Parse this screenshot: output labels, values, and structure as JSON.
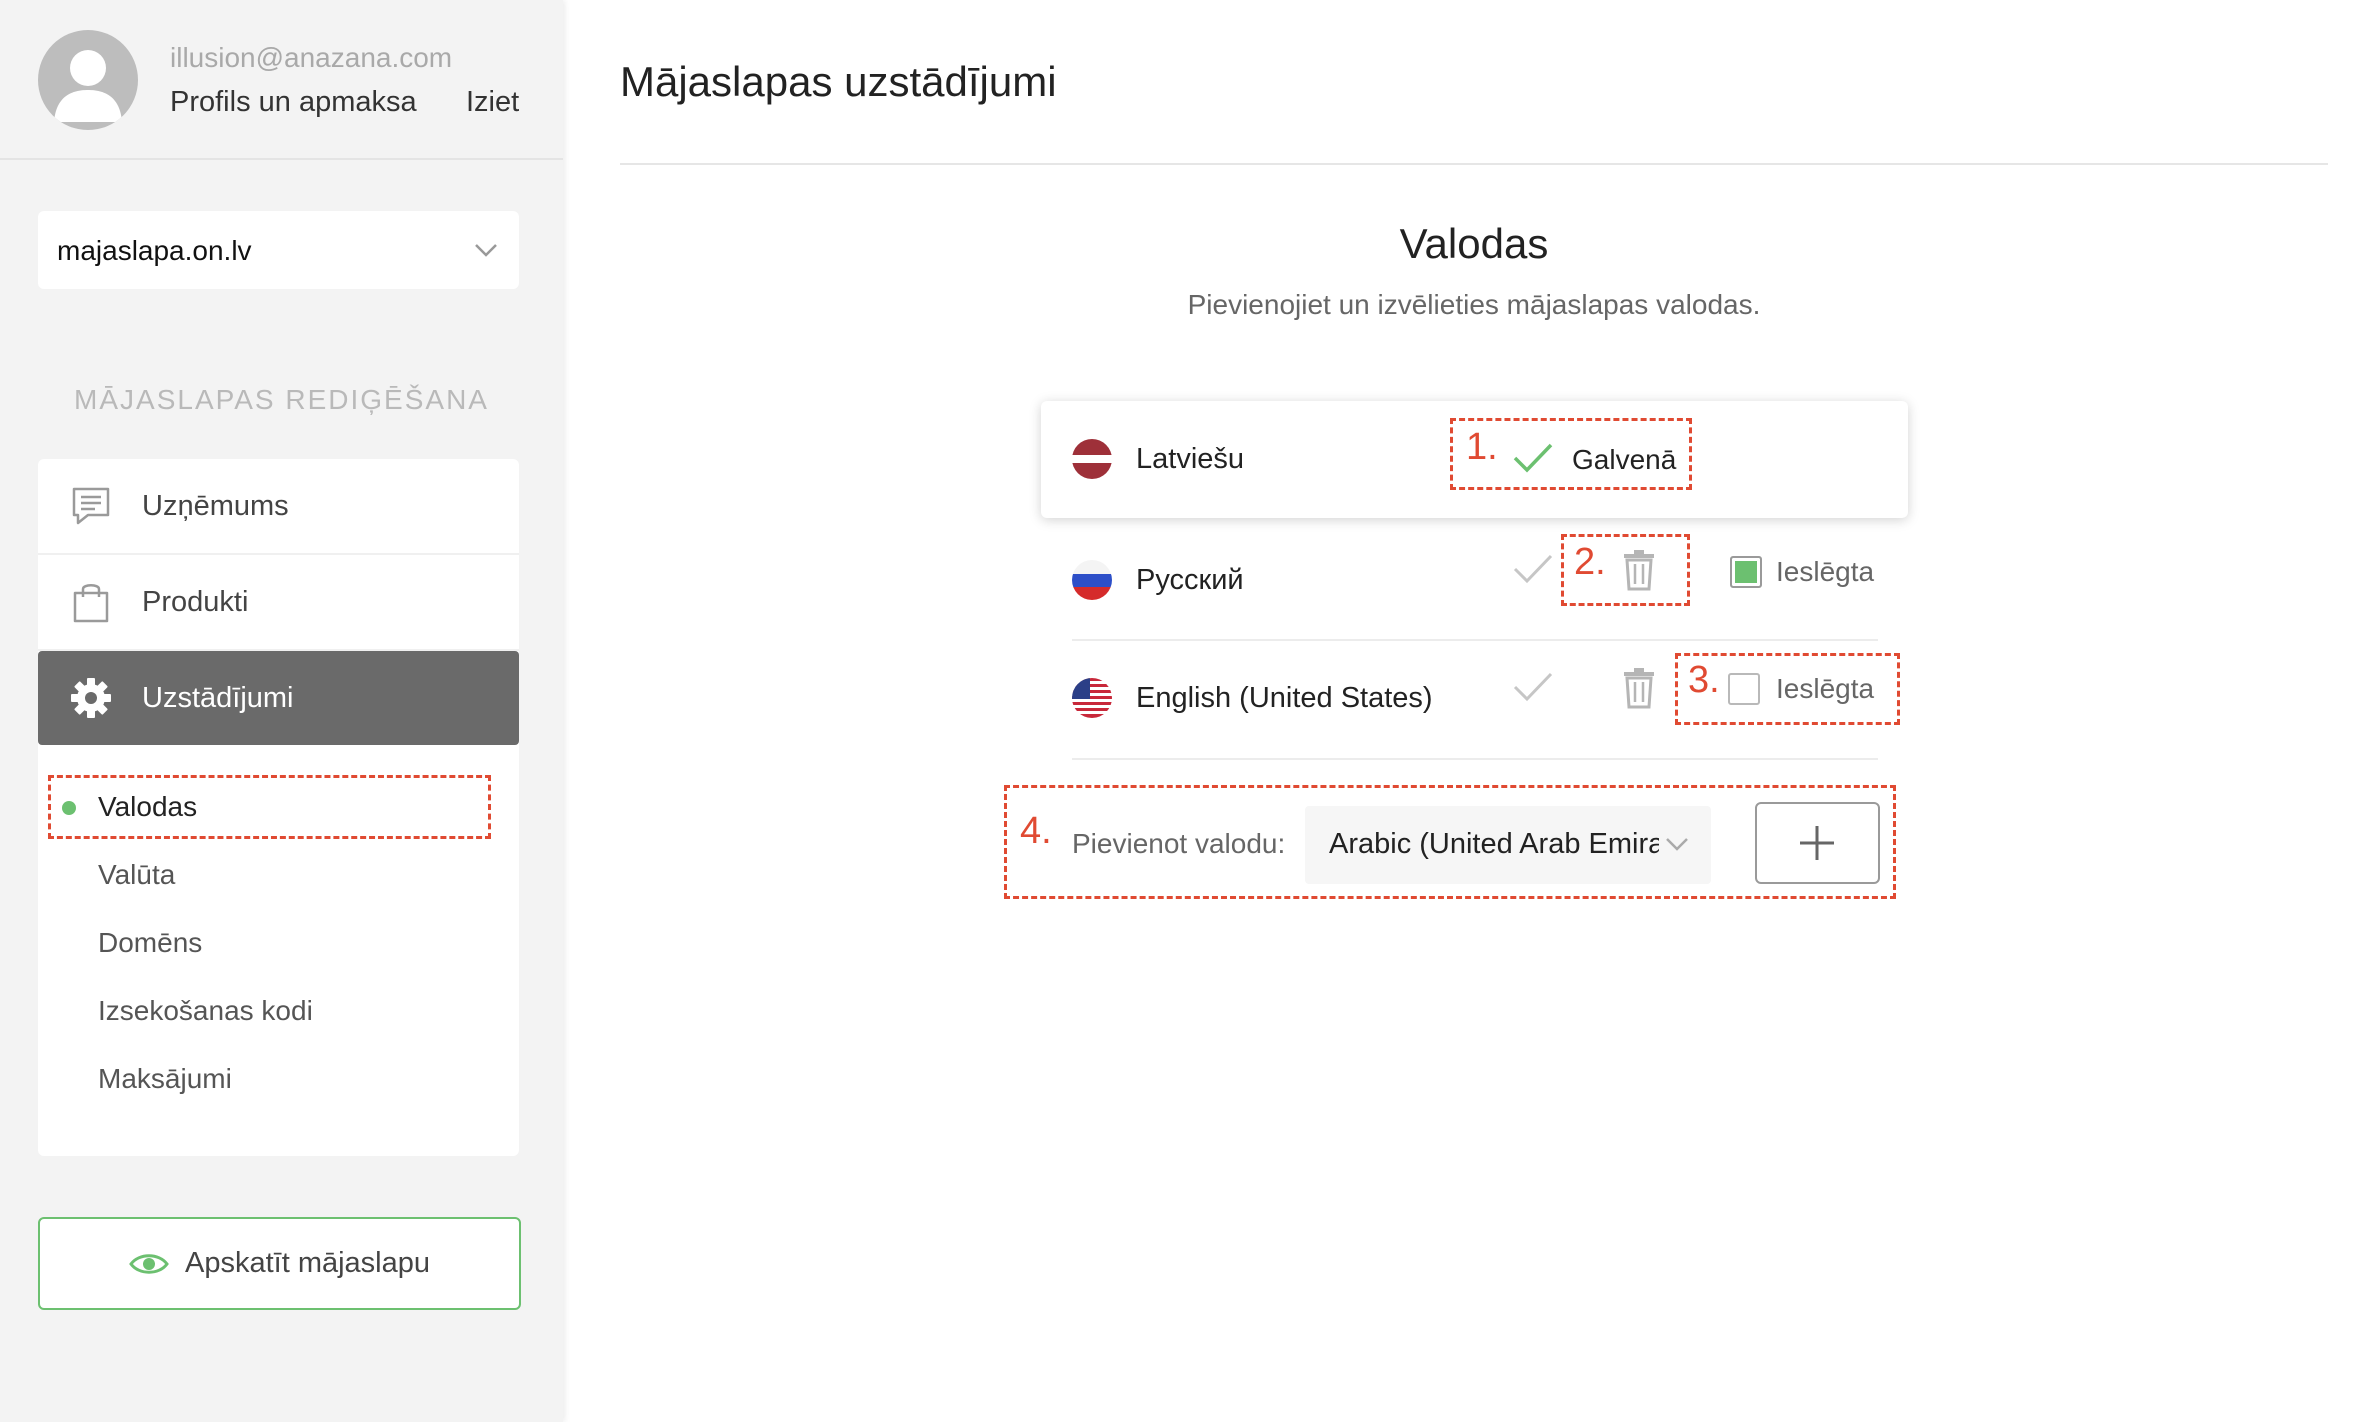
{
  "user": {
    "email": "illusion@anazana.com",
    "profile_link": "Profils un apmaksa",
    "logout_link": "Iziet"
  },
  "site_selector": {
    "value": "majaslapa.on.lv"
  },
  "sidebar": {
    "section_title": "MĀJASLAPAS REDIĢĒŠANA",
    "menu": [
      {
        "label": "Uzņēmums",
        "icon": "message-icon"
      },
      {
        "label": "Produkti",
        "icon": "shopping-bag-icon"
      },
      {
        "label": "Uzstādījumi",
        "icon": "gear-icon",
        "active": true
      }
    ],
    "submenu": [
      {
        "label": "Valodas",
        "active": true
      },
      {
        "label": "Valūta"
      },
      {
        "label": "Domēns"
      },
      {
        "label": "Izsekošanas kodi"
      },
      {
        "label": "Maksājumi"
      }
    ],
    "view_site_button": "Apskatīt mājaslapu"
  },
  "main": {
    "page_title": "Mājaslapas uzstādījumi",
    "section_heading": "Valodas",
    "section_subtitle": "Pievienojiet un izvēlieties mājaslapas valodas.",
    "languages": [
      {
        "name": "Latviešu",
        "flag": "latvia-flag-icon",
        "main_label": "Galvenā",
        "is_main": true
      },
      {
        "name": "Русский",
        "flag": "russia-flag-icon",
        "enabled_label": "Ieslēgta",
        "enabled": true
      },
      {
        "name": "English (United States)",
        "flag": "usa-flag-icon",
        "enabled_label": "Ieslēgta",
        "enabled": false
      }
    ],
    "add_language": {
      "label": "Pievienot valodu:",
      "selected": "Arabic (United Arab Emirates)"
    },
    "annotations": [
      "1.",
      "2.",
      "3.",
      "4."
    ],
    "accent_color": "#6cc070",
    "annotation_color": "#e04a32"
  }
}
